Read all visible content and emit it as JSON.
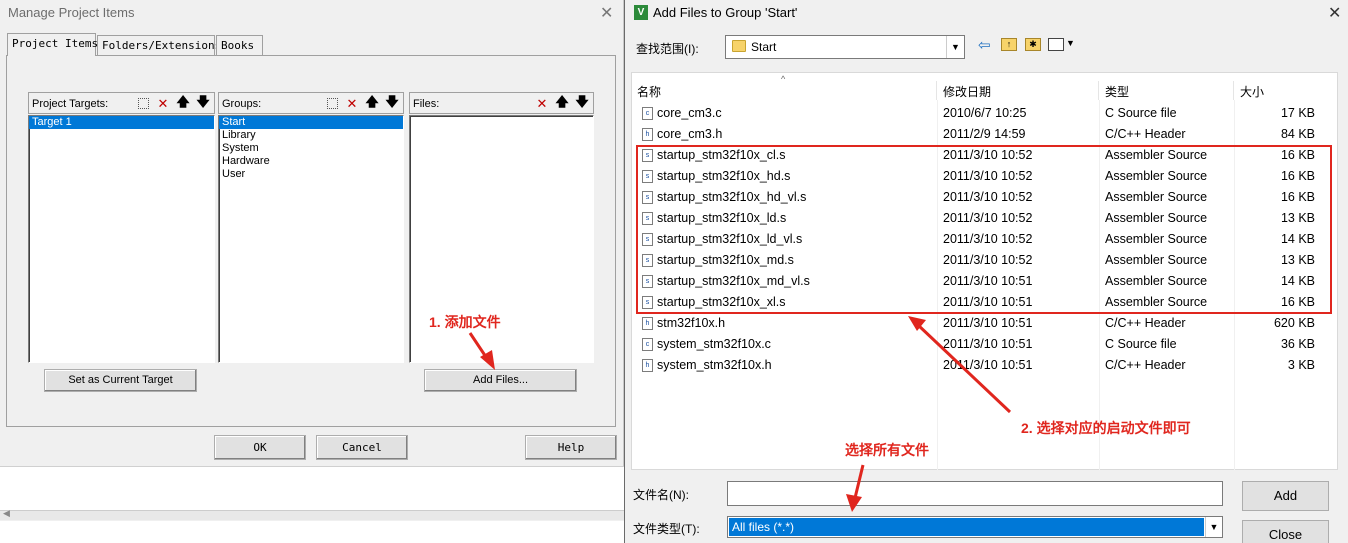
{
  "manage_dialog": {
    "title": "Manage Project Items",
    "tabs": [
      "Project Items",
      "Folders/Extensions",
      "Books"
    ],
    "targets_label": "Project Targets:",
    "targets": [
      "Target 1"
    ],
    "groups_label": "Groups:",
    "groups": [
      "Start",
      "Library",
      "System",
      "Hardware",
      "User"
    ],
    "files_label": "Files:",
    "set_current_target_label": "Set as Current Target",
    "add_files_label": "Add Files...",
    "ok_label": "OK",
    "cancel_label": "Cancel",
    "help_label": "Help"
  },
  "add_dialog": {
    "title": "Add Files to Group 'Start'",
    "look_in_label": "查找范围(I):",
    "look_in_value": "Start",
    "columns": [
      "名称",
      "修改日期",
      "类型",
      "大小"
    ],
    "files": [
      {
        "name": "core_cm3.c",
        "date": "2010/6/7 10:25",
        "type": "C Source file",
        "size": "17 KB",
        "icon": "c-source-icon"
      },
      {
        "name": "core_cm3.h",
        "date": "2011/2/9 14:59",
        "type": "C/C++ Header",
        "size": "84 KB",
        "icon": "header-icon"
      },
      {
        "name": "startup_stm32f10x_cl.s",
        "date": "2011/3/10 10:52",
        "type": "Assembler Source",
        "size": "16 KB",
        "icon": "asm-icon"
      },
      {
        "name": "startup_stm32f10x_hd.s",
        "date": "2011/3/10 10:52",
        "type": "Assembler Source",
        "size": "16 KB",
        "icon": "asm-icon"
      },
      {
        "name": "startup_stm32f10x_hd_vl.s",
        "date": "2011/3/10 10:52",
        "type": "Assembler Source",
        "size": "16 KB",
        "icon": "asm-icon"
      },
      {
        "name": "startup_stm32f10x_ld.s",
        "date": "2011/3/10 10:52",
        "type": "Assembler Source",
        "size": "13 KB",
        "icon": "asm-icon"
      },
      {
        "name": "startup_stm32f10x_ld_vl.s",
        "date": "2011/3/10 10:52",
        "type": "Assembler Source",
        "size": "14 KB",
        "icon": "asm-icon"
      },
      {
        "name": "startup_stm32f10x_md.s",
        "date": "2011/3/10 10:52",
        "type": "Assembler Source",
        "size": "13 KB",
        "icon": "asm-icon"
      },
      {
        "name": "startup_stm32f10x_md_vl.s",
        "date": "2011/3/10 10:51",
        "type": "Assembler Source",
        "size": "14 KB",
        "icon": "asm-icon"
      },
      {
        "name": "startup_stm32f10x_xl.s",
        "date": "2011/3/10 10:51",
        "type": "Assembler Source",
        "size": "16 KB",
        "icon": "asm-icon"
      },
      {
        "name": "stm32f10x.h",
        "date": "2011/3/10 10:51",
        "type": "C/C++ Header",
        "size": "620 KB",
        "icon": "header-icon"
      },
      {
        "name": "system_stm32f10x.c",
        "date": "2011/3/10 10:51",
        "type": "C Source file",
        "size": "36 KB",
        "icon": "c-source-icon"
      },
      {
        "name": "system_stm32f10x.h",
        "date": "2011/3/10 10:51",
        "type": "C/C++ Header",
        "size": "3 KB",
        "icon": "header-icon"
      }
    ],
    "filename_label": "文件名(N):",
    "filename_value": "",
    "filetype_label": "文件类型(T):",
    "filetype_value": "All files (*.*)",
    "add_label": "Add",
    "close_label": "Close"
  },
  "annotations": {
    "step1": "1. 添加文件",
    "step2": "2. 选择对应的启动文件即可",
    "select_all": "选择所有文件",
    "color": "#e0261e"
  }
}
